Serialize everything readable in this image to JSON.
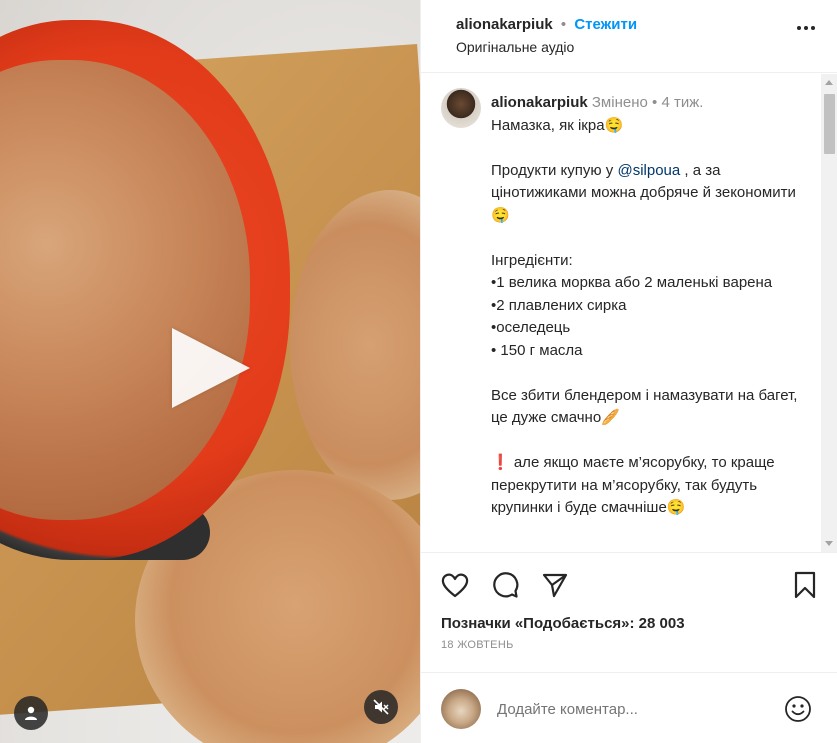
{
  "header": {
    "username": "alionakarpiuk",
    "separator": "•",
    "follow_label": "Стежити",
    "audio": "Оригінальне аудіо"
  },
  "caption": {
    "username": "alionakarpiuk",
    "edited": "Змінено",
    "separator": "•",
    "age": "4 тиж.",
    "line_title": "Намазка, як ікра🤤",
    "line_products_1": "Продукти купую у ",
    "mention": "@silpoua",
    "line_products_2": " , а за цінотижиками можна добряче й зекономити🤤",
    "ingredients_title": "Інгредієнти:",
    "ingredient_1": "•1 велика морква або 2 маленькі варена",
    "ingredient_2": "•2 плавлених сирка",
    "ingredient_3": "•оселедець",
    "ingredient_4": "• 150 г масла",
    "instructions": "Все збити блендером і намазувати на багет, це дуже смачно🥖",
    "tip": "❗ але якщо маєте м’ясорубку, то краще перекрутити на м’ясорубку, так будуть крупинки і буде смачніше🤤"
  },
  "stats": {
    "likes_text": "Позначки «Подобається»: 28 003",
    "date": "18 ЖОВТЕНЬ"
  },
  "comment": {
    "placeholder": "Додайте коментар..."
  },
  "icons": {
    "like": "heart-icon",
    "comment": "comment-icon",
    "share": "paper-plane-icon",
    "save": "bookmark-icon",
    "emoji": "emoji-icon",
    "more": "more-icon",
    "play": "play-icon",
    "user": "user-icon",
    "mute": "muted-speaker-icon"
  },
  "colors": {
    "accent": "#0095f6",
    "text": "#262626",
    "secondary": "#8e8e8e",
    "mention": "#00376b"
  }
}
